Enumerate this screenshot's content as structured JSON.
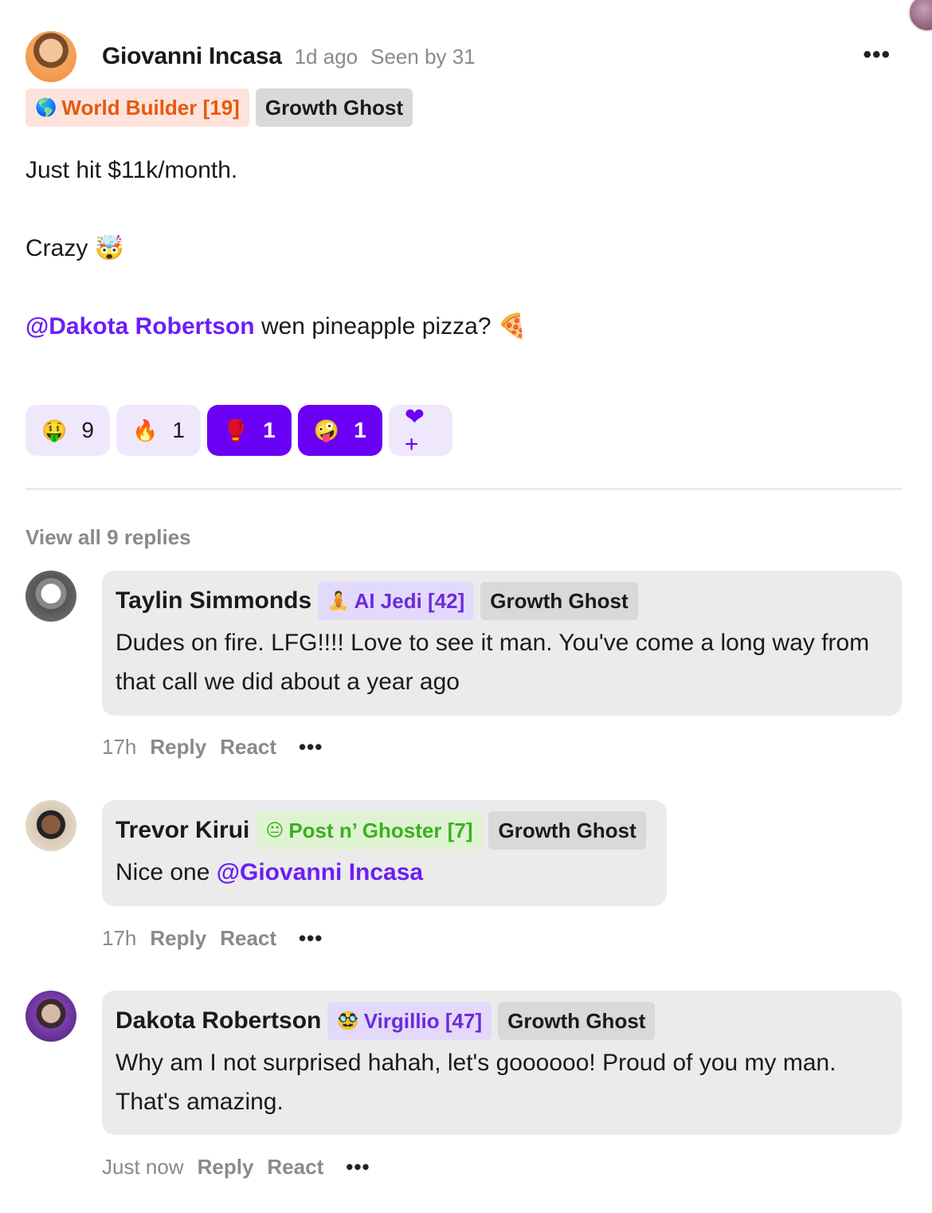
{
  "post": {
    "author": "Giovanni Incasa",
    "time": "1d ago",
    "seen": "Seen by 31",
    "more_icon": "more-dots-icon",
    "badges": [
      {
        "emoji": "🌎",
        "label": "World Builder [19]",
        "color": "#e8570c",
        "bg": "#fde3dc"
      },
      {
        "label": "Growth Ghost",
        "color": "#1a1a1a",
        "bg": "#d9d9d9"
      }
    ],
    "body": {
      "line1": "Just hit $11k/month.",
      "line2": "Crazy 🤯",
      "mention": "@Dakota Robertson",
      "line3_rest": " wen pineapple pizza? 🍕"
    },
    "reactions": [
      {
        "emoji": "🤑",
        "count": "9",
        "active": false
      },
      {
        "emoji": "🔥",
        "count": "1",
        "active": false
      },
      {
        "emoji": "🥊",
        "count": "1",
        "active": true
      },
      {
        "emoji": "🤪",
        "count": "1",
        "active": true
      }
    ],
    "add_reaction_icon": "heart-plus-icon",
    "add_reaction_glyph": "❤+",
    "accent": "#6a00f4"
  },
  "view_all": "View all 9 replies",
  "replies": [
    {
      "name": "Taylin Simmonds",
      "badge_emoji": "🧘",
      "badge_label": "AI Jedi [42]",
      "role": "Growth Ghost",
      "text": "Dudes on fire. LFG!!!! Love to see it man. You've come a long way from that call we did about a year ago",
      "time": "17h",
      "reply": "Reply",
      "react": "React",
      "dots": "•••"
    },
    {
      "name": "Trevor Kirui",
      "badge_emoji": "😐",
      "badge_label": "Post n’ Ghoster [7]",
      "role": "Growth Ghost",
      "text_prefix": "Nice one ",
      "mention": "@Giovanni Incasa",
      "time": "17h",
      "reply": "Reply",
      "react": "React",
      "dots": "•••"
    },
    {
      "name": "Dakota Robertson",
      "badge_emoji": "🥸",
      "badge_label": "Virgillio [47]",
      "role": "Growth Ghost",
      "text": "Why am I not surprised hahah, let's goooooo! Proud of you my man. That's amazing.",
      "time": "Just now",
      "reply": "Reply",
      "react": "React",
      "dots": "•••"
    }
  ]
}
